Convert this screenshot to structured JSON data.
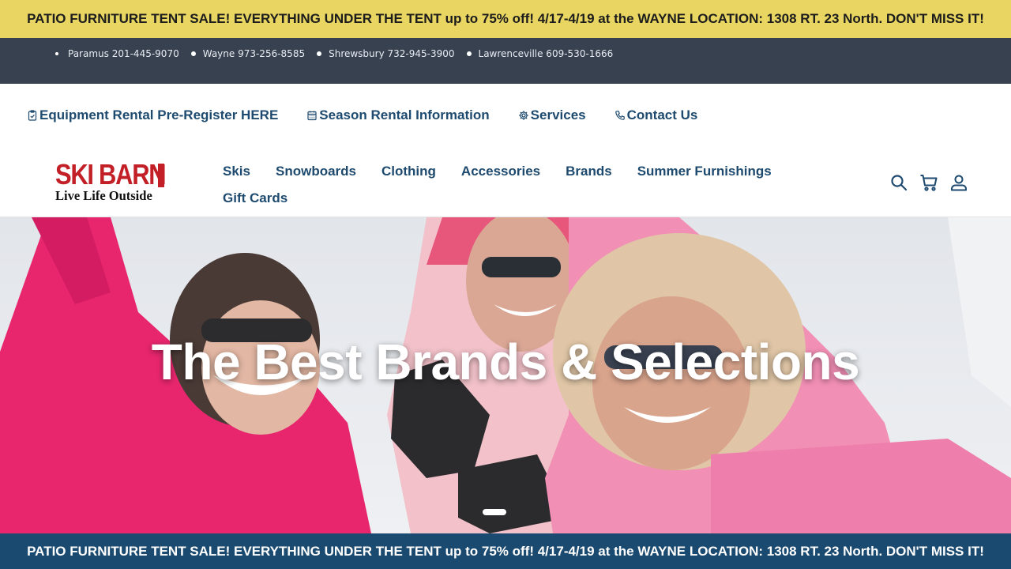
{
  "promo_banner": {
    "text": "PATIO FURNITURE TENT SALE! EVERYTHING UNDER THE TENT up to 75% off! 4/17-4/19 at the WAYNE LOCATION: 1308 RT. 23 North. DON'T MISS IT!"
  },
  "locations": [
    {
      "label": "Paramus 201-445-9070"
    },
    {
      "label": "Wayne 973-256-8585"
    },
    {
      "label": "Shrewsbury 732-945-3900"
    },
    {
      "label": "Lawrenceville 609-530-1666"
    }
  ],
  "utility_nav": [
    {
      "label": "Equipment Rental Pre-Register HERE",
      "icon": "clipboard-check-icon"
    },
    {
      "label": "Season Rental Information",
      "icon": "calendar-icon"
    },
    {
      "label": "Services",
      "icon": "gear-icon"
    },
    {
      "label": "Contact Us",
      "icon": "phone-icon"
    }
  ],
  "logo": {
    "brand": "SKI BARN",
    "tagline": "Live Life Outside"
  },
  "primary_nav": {
    "row1": [
      "Skis",
      "Snowboards",
      "Clothing",
      "Accessories",
      "Brands",
      "Summer Furnishings"
    ],
    "row2": [
      "Gift Cards"
    ]
  },
  "header_icons": [
    "search-icon",
    "cart-icon",
    "account-icon"
  ],
  "hero": {
    "title": "The Best Brands & Selections",
    "slide_count": 1,
    "active_slide": 1
  },
  "colors": {
    "promo_top_bg": "#e8d562",
    "locations_bg": "#374150",
    "nav_text": "#1d4a6e",
    "brand_red": "#c21f26",
    "promo_bottom_bg": "#1b4a70"
  }
}
